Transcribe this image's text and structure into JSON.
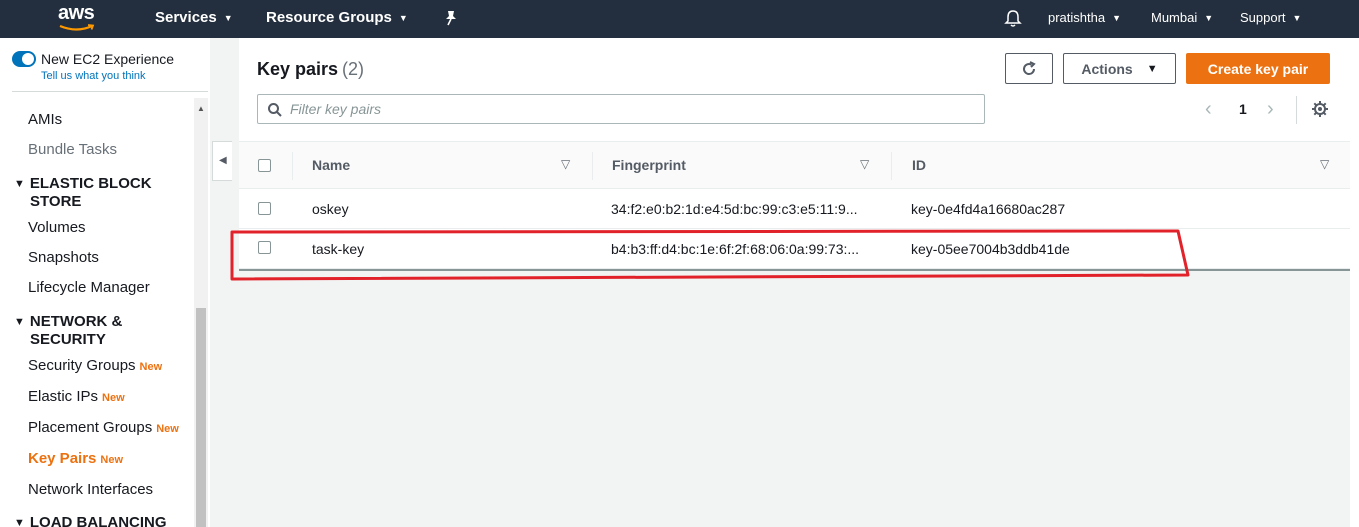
{
  "topnav": {
    "logo_text": "aws",
    "services_label": "Services",
    "resource_groups_label": "Resource Groups",
    "user_label": "pratishtha",
    "region_label": "Mumbai",
    "support_label": "Support",
    "caret_icon": "chevron-down-icon",
    "pin_icon": "pin-icon",
    "bell_icon": "bell-icon",
    "background_color": "#232f3e"
  },
  "sidebar": {
    "new_experience_label": "New EC2 Experience",
    "feedback_link": "Tell us what you think",
    "items": [
      {
        "label": "AMIs",
        "style": "normal"
      },
      {
        "label": "Bundle Tasks",
        "style": "muted"
      }
    ],
    "section_ebs": {
      "line1": "ELASTIC BLOCK",
      "line2": "STORE"
    },
    "ebs_items": [
      "Volumes",
      "Snapshots",
      "Lifecycle Manager"
    ],
    "section_network": {
      "line1": "NETWORK &",
      "line2": "SECURITY"
    },
    "network_items": [
      {
        "label": "Security Groups",
        "badge": "New"
      },
      {
        "label": "Elastic IPs",
        "badge": "New"
      },
      {
        "label": "Placement Groups",
        "badge": "New"
      },
      {
        "label": "Key Pairs",
        "badge": "New",
        "active": true
      },
      {
        "label": "Network Interfaces",
        "badge": ""
      }
    ],
    "section_lb": {
      "line1": "LOAD BALANCING"
    },
    "active_color": "#ec7211",
    "new_badge_color": "#ec7211"
  },
  "main": {
    "title": "Key pairs",
    "count": "(2)",
    "actions_label": "Actions",
    "create_label": "Create key pair",
    "create_color": "#ec7211",
    "search_placeholder": "Filter key pairs",
    "page_number": "1",
    "refresh_icon": "refresh-icon",
    "settings_icon": "gear-icon"
  },
  "table": {
    "headers": [
      "Name",
      "Fingerprint",
      "ID"
    ],
    "rows": [
      {
        "name": "oskey",
        "fingerprint": "34:f2:e0:b2:1d:e4:5d:bc:99:c3:e5:11:9...",
        "id": "key-0e4fd4a16680ac287"
      },
      {
        "name": "task-key",
        "fingerprint": "b4:b3:ff:d4:bc:1e:6f:2f:68:06:0a:99:73:...",
        "id": "key-05ee7004b3ddb41de"
      }
    ]
  },
  "annotation": {
    "color": "#e2222b",
    "target_row": "task-key"
  }
}
